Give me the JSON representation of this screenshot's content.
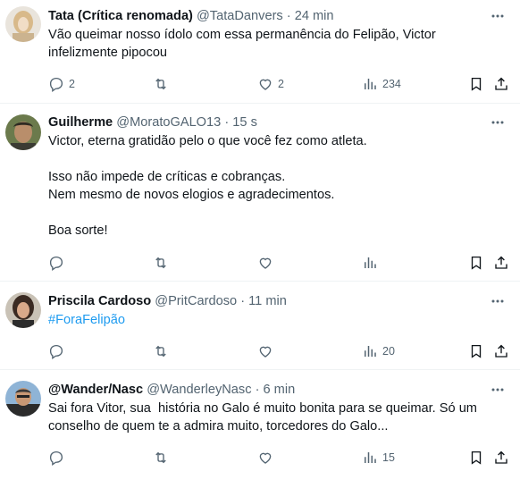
{
  "tweets": [
    {
      "name": "Tata (Crítica renomada)",
      "handle": "@TataDanvers",
      "time": "24 min",
      "text": "Vão queimar nosso ídolo com essa permanência do Felipão, Victor infelizmente pipocou",
      "replies": "2",
      "retweets": "",
      "likes": "2",
      "views": "234"
    },
    {
      "name": "Guilherme",
      "handle": "@MoratoGALO13",
      "time": "15 s",
      "text": "Victor, eterna gratidão pelo o que você fez como atleta.\n\nIsso não impede de críticas e cobranças.\nNem mesmo de novos elogios e agradecimentos.\n\nBoa sorte!",
      "replies": "",
      "retweets": "",
      "likes": "",
      "views": ""
    },
    {
      "name": "Priscila Cardoso",
      "handle": "@PritCardoso",
      "time": "11 min",
      "text": "#ForaFelipão",
      "replies": "",
      "retweets": "",
      "likes": "",
      "views": "20"
    },
    {
      "name": "@Wander/Nasc",
      "handle": "@WanderleyNasc",
      "time": "6 min",
      "text": "Sai fora Vitor, sua  história no Galo é muito bonita para se queimar. Só um conselho de quem te a admira muito, torcedores do Galo...",
      "replies": "",
      "retweets": "",
      "likes": "",
      "views": "15"
    }
  ],
  "separator": "·",
  "colors": {
    "text": "#0f1419",
    "muted": "#536471",
    "link": "#1d9bf0",
    "border": "#eff3f4"
  },
  "icons": [
    "more-icon",
    "reply-icon",
    "retweet-icon",
    "like-icon",
    "views-icon",
    "bookmark-icon",
    "share-icon"
  ]
}
